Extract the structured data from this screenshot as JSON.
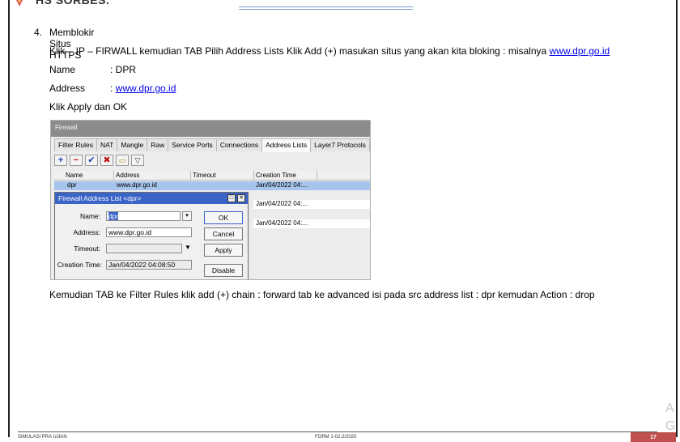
{
  "header": {
    "title": "HS SORBES."
  },
  "document": {
    "step_number": "4.",
    "step_title": "Memblokir Situs HTTPS",
    "instruction_prefix": "Klik – IP – FIRWALL kemudian TAB Pilih Address Lists Klik Add (+) masukan situs yang akan kita bloking : misalnya ",
    "instruction_link": "www.dpr.go.id",
    "name_label": "Name",
    "name_value": ": DPR",
    "address_label": "Address",
    "address_sep": ": ",
    "address_link": "www.dpr.go.id",
    "apply_text": "Klik Apply dan OK",
    "after_text": "Kemudian TAB ke Filter Rules klik add (+) chain : forward tab ke advanced  isi pada src address list : dpr kemudan Action : drop"
  },
  "screenshot": {
    "window_title": "Firewall",
    "tabs": [
      "Filter Rules",
      "NAT",
      "Mangle",
      "Raw",
      "Service Ports",
      "Connections",
      "Address Lists",
      "Layer7 Protocols"
    ],
    "active_tab": "Address Lists",
    "toolbar_icons": [
      "add-icon",
      "remove-icon",
      "enable-icon",
      "disable-icon",
      "comment-icon",
      "filter-icon"
    ],
    "columns": [
      "Name",
      "Address",
      "Timeout",
      "Creation Time"
    ],
    "selected_row": {
      "name": "dpr",
      "address": "www.dpr.go.id",
      "timeout": "",
      "creation_time": "Jan/04/2022 04:..."
    },
    "other_rows": [
      "Jan/04/2022 04:...",
      "Jan/04/2022 04:..."
    ],
    "dialog": {
      "title": "Firewall Address List <dpr>",
      "name_label": "Name:",
      "name_value": "dpr",
      "address_label": "Address:",
      "address_value": "www.dpr.go.id",
      "timeout_label": "Timeout:",
      "timeout_value": "",
      "creation_label": "Creation Time:",
      "creation_value": "Jan/04/2022 04:08:50",
      "buttons": [
        "OK",
        "Cancel",
        "Apply",
        "Disable"
      ]
    }
  },
  "footer": {
    "left": "SIMULASI PRA UJIAN",
    "mid": "FORM 1-02.2/2020",
    "page": "17",
    "watermark": "A\nG"
  },
  "colors": {
    "link": "#0000ee",
    "page_badge": "#c0504d",
    "dialog_title": "#3a64c8",
    "selected_row": "#a6c4ec"
  }
}
